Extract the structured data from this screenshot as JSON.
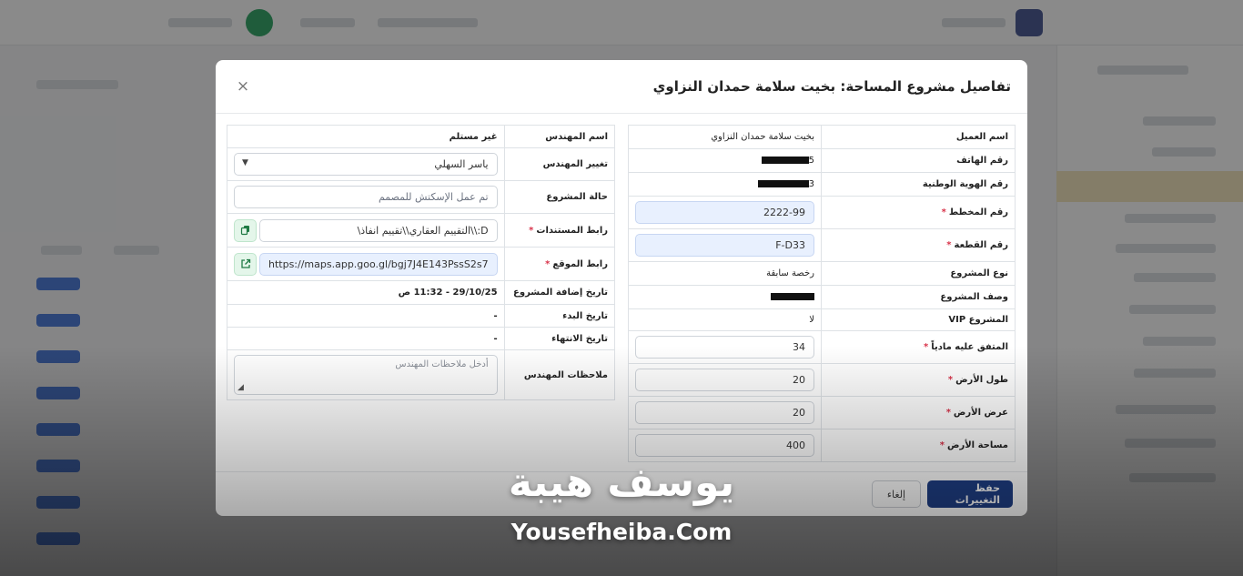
{
  "modal": {
    "title": "تفاصيل مشروع المساحة: بخيت سلامة حمدان النزاوي",
    "close": "×",
    "client_details": {
      "client_name_label": "اسم العميل",
      "client_name_value": "بخيت سلامة حمدان النزاوي",
      "phone_label": "رقم الهاتف",
      "phone_value_prefix": "5",
      "national_id_label": "رقم الهوية الوطنية",
      "national_id_value_prefix": "3",
      "plan_number_label": "رقم المخطط",
      "plan_number_value": "2222-99",
      "plot_number_label": "رقم القطعة",
      "plot_number_value": "F-D33",
      "project_type_label": "نوع المشروع",
      "project_type_value": "رخصة سابقة",
      "project_description_label": "وصف المشروع",
      "vip_label": "المشروع VIP",
      "vip_value": "لا",
      "agreed_price_label": "المتفق عليه مادياً",
      "agreed_price_value": "34",
      "land_length_label": "طول الأرض",
      "land_length_value": "20",
      "land_width_label": "عرض الأرض",
      "land_width_value": "20",
      "land_area_label": "مساحة الأرض",
      "land_area_value": "400"
    },
    "engineer_details": {
      "engineer_name_label": "اسم المهندس",
      "engineer_name_value": "غير مستلم",
      "change_engineer_label": "تغيير المهندس",
      "change_engineer_value": "ياسر السهلي",
      "project_status_label": "حالة المشروع",
      "project_status_value": "تم عمل الإسكتش للمصمم",
      "documents_link_label": "رابط المستندات",
      "documents_link_value": "D:\\\\التقييم العقاري\\\\تقييم انفاذ\\",
      "location_link_label": "رابط الموقع",
      "location_link_value": "https://maps.app.goo.gl/bgj7J4E143PssS2s7",
      "date_added_label": "تاريخ إضافة المشروع",
      "date_added_value": "29/10/25 - 11:32 ص",
      "start_date_label": "تاريخ البدء",
      "start_date_value": "-",
      "end_date_label": "تاريخ الانتهاء",
      "end_date_value": "-",
      "engineer_notes_label": "ملاحظات المهندس",
      "engineer_notes_placeholder": "أدخل ملاحظات المهندس"
    },
    "footer": {
      "save_label": "حفظ التغييرات",
      "cancel_label": "إلغاء"
    }
  },
  "watermark": {
    "arabic": "يوسف هيبة",
    "latin": "Yousefheiba.Com"
  },
  "colors": {
    "primary": "#1f3f86",
    "required": "#d9334a",
    "input_blue": "#e8f0fe",
    "link_button": "#e4f6ea"
  },
  "icons": {
    "copy": "copy-icon",
    "external_link": "external-link-icon",
    "dropdown": "chevron-down-icon",
    "close": "close-icon"
  }
}
